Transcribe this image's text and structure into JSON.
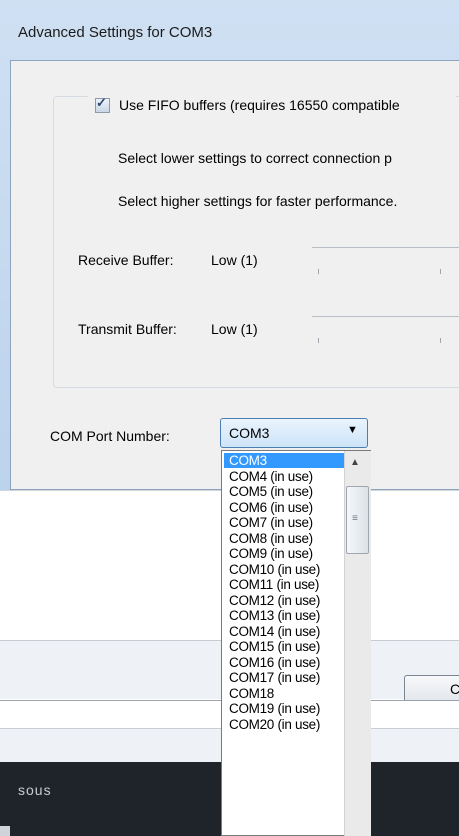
{
  "dialog": {
    "title": "Advanced Settings for COM3",
    "fifo_checked": true,
    "fifo_label": "Use FIFO buffers (requires 16550 compatible",
    "info_lower": "Select lower settings to correct connection p",
    "info_higher": "Select higher settings for faster performance.",
    "receive_buffer_label": "Receive Buffer:",
    "receive_buffer_value": "Low (1)",
    "transmit_buffer_label": "Transmit Buffer:",
    "transmit_buffer_value": "Low (1)",
    "com_port_label": "COM Port Number:",
    "com_port_selected": "COM3",
    "combo_arrow_icon": "chevron-down-icon"
  },
  "dropdown": {
    "items": [
      "COM3",
      "COM4 (in use)",
      "COM5 (in use)",
      "COM6 (in use)",
      "COM7 (in use)",
      "COM8 (in use)",
      "COM9 (in use)",
      "COM10 (in use)",
      "COM11 (in use)",
      "COM12 (in use)",
      "COM13 (in use)",
      "COM14 (in use)",
      "COM15 (in use)",
      "COM16 (in use)",
      "COM17 (in use)",
      "COM18",
      "COM19 (in use)",
      "COM20 (in use)"
    ],
    "selected_index": 0,
    "selection_color": "#3399ff"
  },
  "background": {
    "button_label": "C",
    "dark_text": "sous"
  }
}
